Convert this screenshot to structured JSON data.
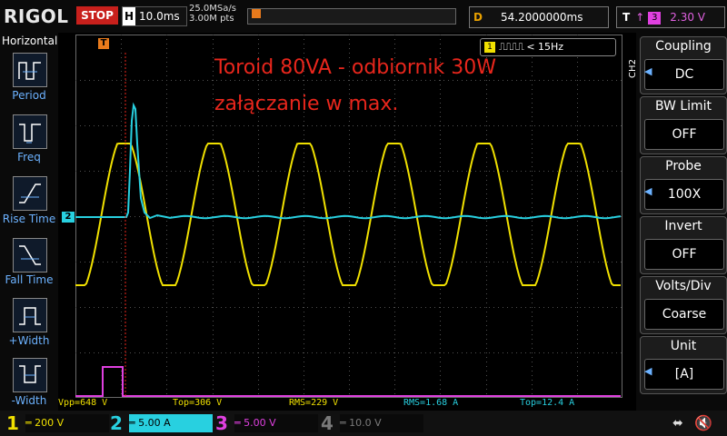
{
  "topbar": {
    "logo": "RIGOL",
    "run_state": "STOP",
    "timebase_tag": "H",
    "timebase": "10.0ms",
    "sample_rate": "25.0MSa/s",
    "memory_depth": "3.00M pts",
    "delay_tag": "D",
    "delay": "54.2000000ms",
    "trigger_tag": "T",
    "trigger_source": "3",
    "trigger_level": "2.30 V",
    "trigger_edge_icon": "rising-edge-icon"
  },
  "left_panel": {
    "title": "Horizontal",
    "items": [
      {
        "label": "Period",
        "icon": "period-icon"
      },
      {
        "label": "Freq",
        "icon": "freq-icon"
      },
      {
        "label": "Rise Time",
        "icon": "rise-time-icon"
      },
      {
        "label": "Fall Time",
        "icon": "fall-time-icon"
      },
      {
        "label": "+Width",
        "icon": "positive-width-icon"
      },
      {
        "label": "-Width",
        "icon": "negative-width-icon"
      }
    ]
  },
  "screen": {
    "annotation_line1": "Toroid 80VA - odbiornik 30W",
    "annotation_line2": "załączanie w max.",
    "freq_badge_channel": "1",
    "freq_badge_text": "< 15Hz",
    "ch2_marker": "2",
    "trigger_marker": "T"
  },
  "measurements": [
    {
      "text": "Vpp=648 V",
      "color": "#f0e000"
    },
    {
      "text": "Top=306 V",
      "color": "#f0e000"
    },
    {
      "text": "RMS=229 V",
      "color": "#f0e000"
    },
    {
      "text": "RMS=1.68 A",
      "color": "#28d0e0"
    },
    {
      "text": "Top=12.4 A",
      "color": "#28d0e0"
    }
  ],
  "right_panel": {
    "channel_label": "CH2",
    "items": [
      {
        "header": "Coupling",
        "value": "DC"
      },
      {
        "header": "BW Limit",
        "value": "OFF"
      },
      {
        "header": "Probe",
        "value": "100X"
      },
      {
        "header": "Invert",
        "value": "OFF"
      },
      {
        "header": "Volts/Div",
        "value": "Coarse"
      },
      {
        "header": "Unit",
        "value": "[A]"
      }
    ]
  },
  "channels": [
    {
      "number": "1",
      "scale": "200 V",
      "color": "#f0e000",
      "active": true
    },
    {
      "number": "2",
      "scale": "5.00 A",
      "color": "#28d0e0",
      "active": true
    },
    {
      "number": "3",
      "scale": "5.00 V",
      "color": "#e040e0",
      "active": true
    },
    {
      "number": "4",
      "scale": "10.0 V",
      "color": "#7a7a7a",
      "active": false
    }
  ],
  "status_icons": [
    "usb-icon",
    "speaker-mute-icon"
  ],
  "colors": {
    "ch1": "#f0e000",
    "ch2": "#28d0e0",
    "ch3": "#e040e0",
    "accent": "#e87a1c",
    "stop": "#c8201c",
    "annotation": "#e8261c"
  }
}
